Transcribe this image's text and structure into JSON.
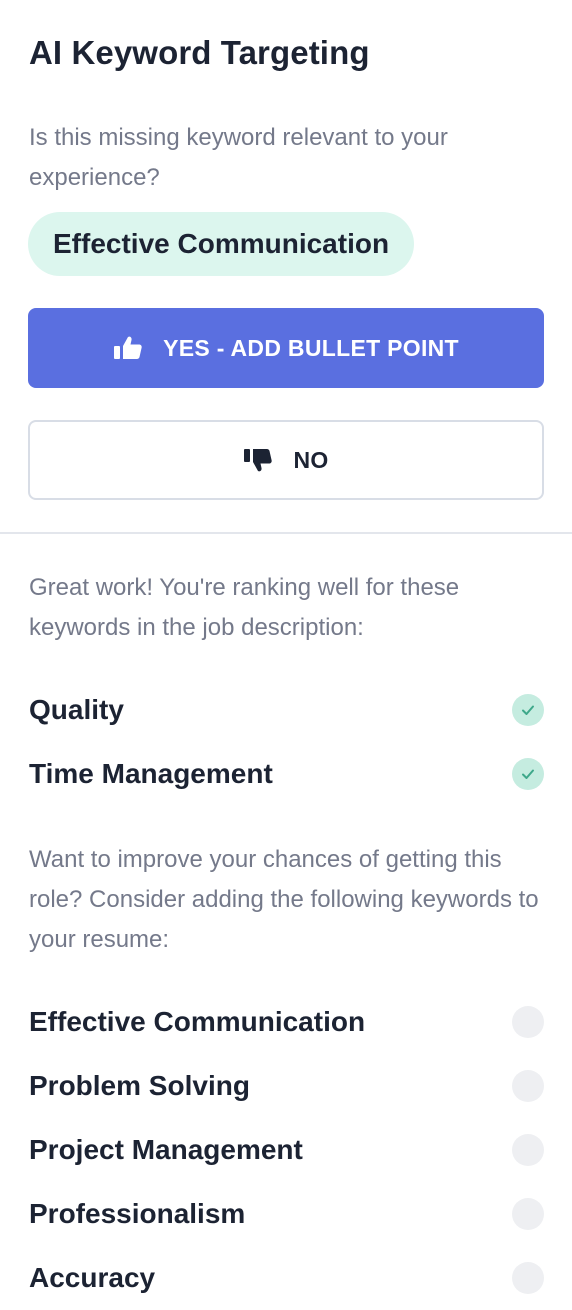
{
  "panel": {
    "title": "AI Keyword Targeting",
    "prompt": "Is this missing keyword relevant to your experience?",
    "current_keyword": "Effective Communication",
    "yes_button": {
      "label": "YES - ADD BULLET POINT",
      "icon": "thumbs-up-icon"
    },
    "no_button": {
      "label": "NO",
      "icon": "thumbs-down-icon"
    }
  },
  "ranking": {
    "message": "Great work! You're ranking well for these keywords in the job description:",
    "keywords": [
      {
        "label": "Quality",
        "status": "matched"
      },
      {
        "label": "Time Management",
        "status": "matched"
      }
    ]
  },
  "improve": {
    "message": "Want to improve your chances of getting this role? Consider adding the following keywords to your resume:",
    "keywords": [
      {
        "label": "Effective Communication",
        "status": "missing"
      },
      {
        "label": "Problem Solving",
        "status": "missing"
      },
      {
        "label": "Project Management",
        "status": "missing"
      },
      {
        "label": "Professionalism",
        "status": "missing"
      },
      {
        "label": "Accuracy",
        "status": "missing"
      }
    ]
  },
  "colors": {
    "primary": "#5a6fe0",
    "chip_bg": "#dcf6ee",
    "check_bg": "#c5ece0",
    "check_mark": "#3ea88a",
    "pending_bg": "#eeeff2",
    "muted_text": "#74798a"
  }
}
